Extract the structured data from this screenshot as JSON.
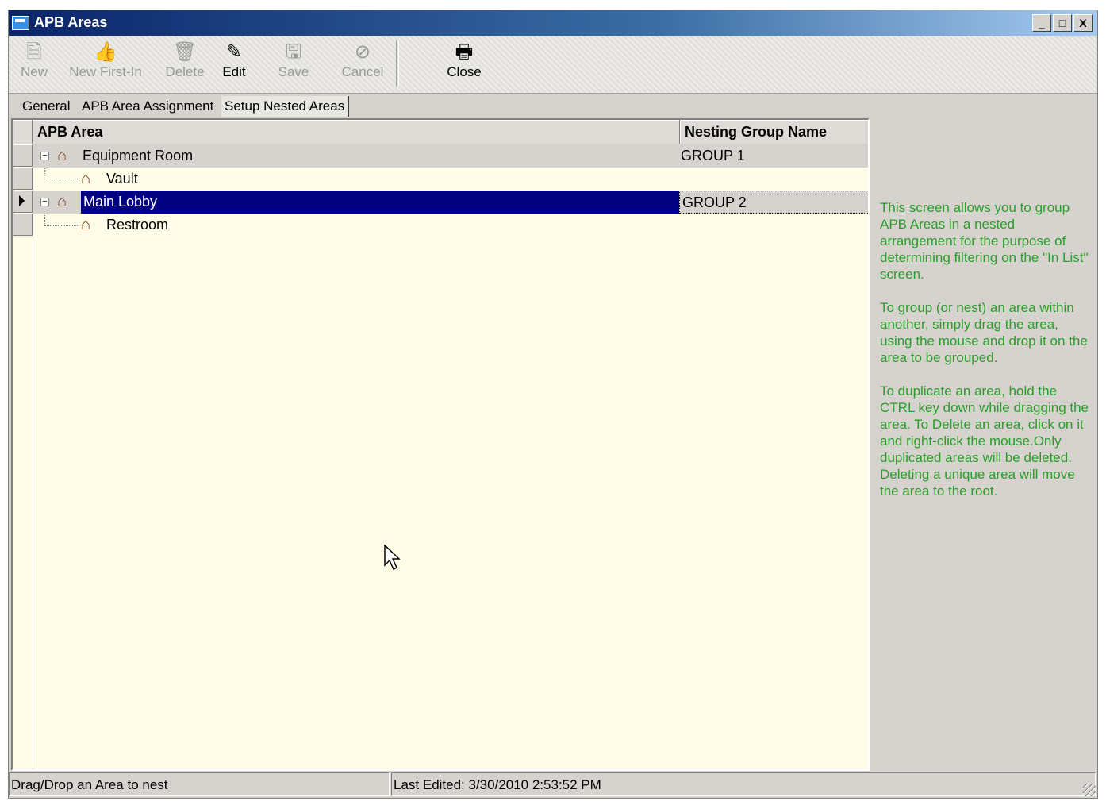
{
  "window": {
    "title": "APB Areas",
    "buttons": [
      "_",
      "□",
      "X"
    ]
  },
  "toolbar": {
    "new": "New",
    "new_first_in": "New First-In",
    "delete": "Delete",
    "edit": "Edit",
    "save": "Save",
    "cancel": "Cancel",
    "close": "Close"
  },
  "tabs": [
    "General",
    "APB Area Assignment",
    "Setup Nested Areas"
  ],
  "grid": {
    "columns": [
      "APB Area",
      "Nesting Group Name"
    ],
    "rows": [
      {
        "name": "Equipment Room",
        "group": "GROUP 1",
        "level": 0
      },
      {
        "name": "Vault",
        "group": "",
        "level": 1
      },
      {
        "name": "Main Lobby",
        "group": "GROUP 2",
        "level": 0,
        "selected": true
      },
      {
        "name": "Restroom",
        "group": "",
        "level": 1
      }
    ]
  },
  "help": {
    "p1": "This screen allows you to group APB Areas in a nested arrangement for the purpose of determining filtering on the \"In List\" screen.",
    "p2": "To group (or nest) an area within another, simply drag the area, using the mouse  and drop it on the area to be grouped.",
    "p3": "To duplicate an area, hold the CTRL key down while dragging the area. To Delete an area, click on it and right-click the mouse.Only duplicated areas will be deleted. Deleting a unique area will move the area to the root."
  },
  "status": {
    "left": "Drag/Drop an Area to nest",
    "right": "Last Edited: 3/30/2010 2:53:52 PM"
  },
  "colors": {
    "help_text": "#2a9d2a",
    "selection": "#000080",
    "grid_bg": "#fffde8"
  }
}
